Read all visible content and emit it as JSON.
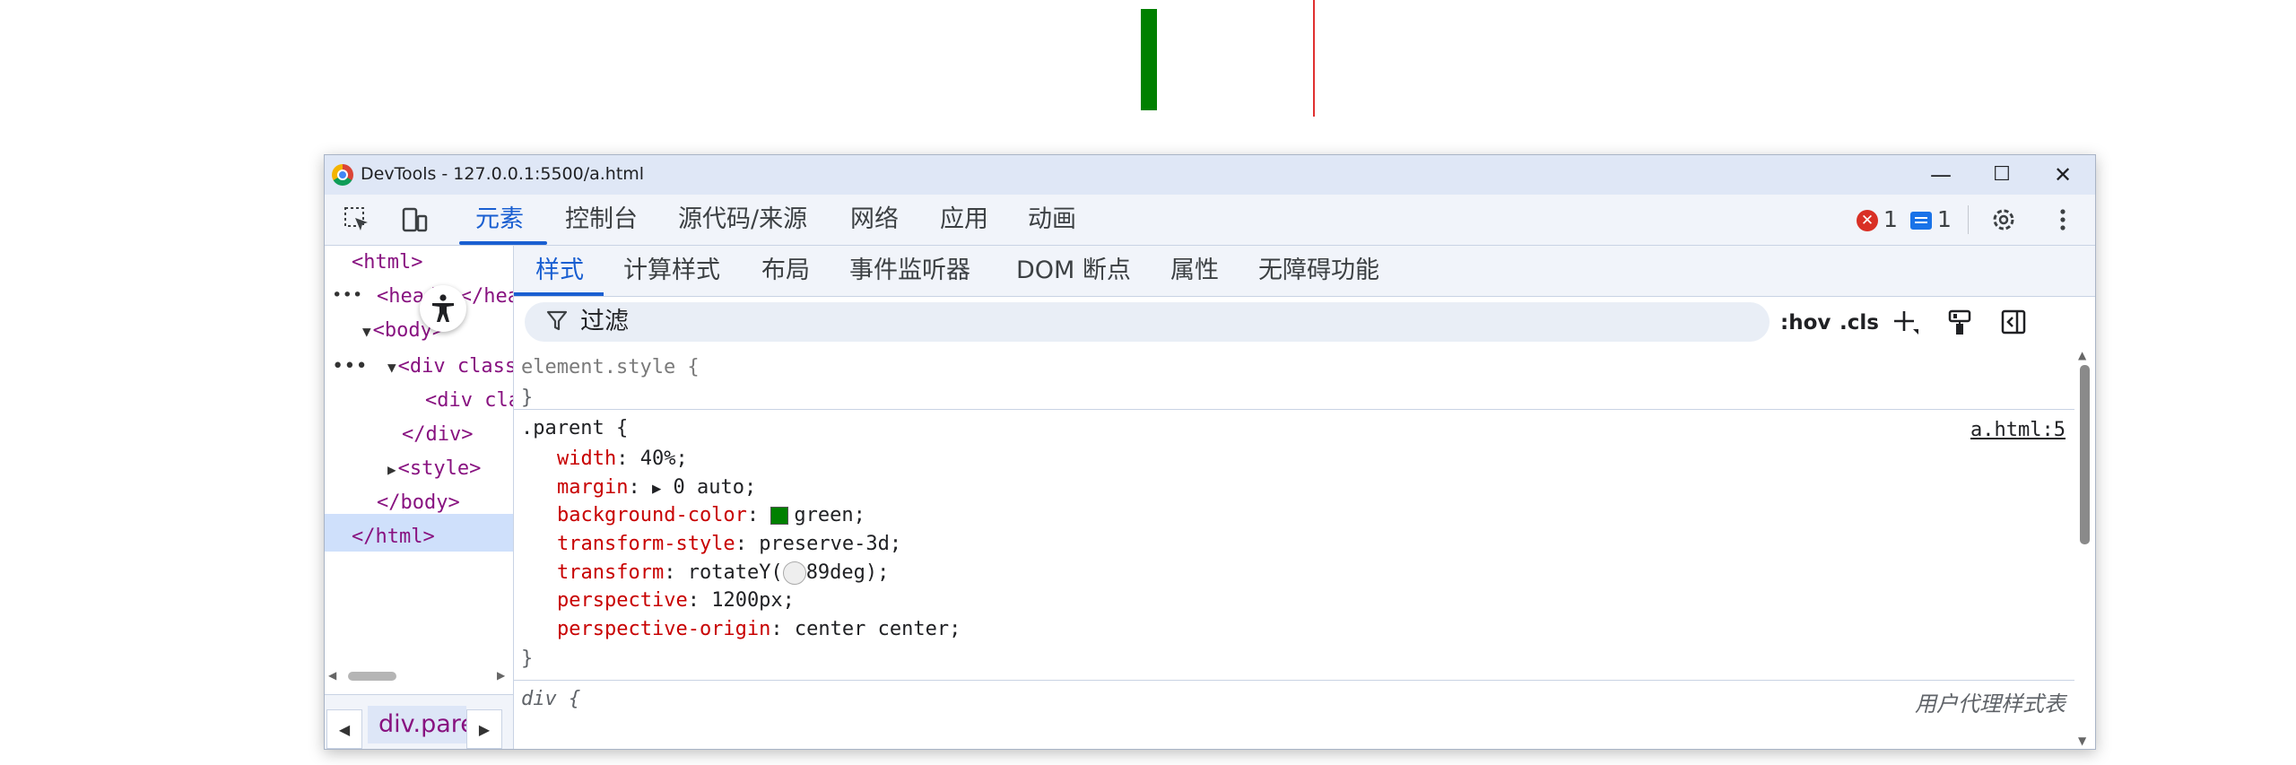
{
  "page": {
    "green_bar_color": "#008000",
    "red_line_color": "#e03030"
  },
  "window": {
    "title": "DevTools - 127.0.0.1:5500/a.html",
    "minimize": "—",
    "maximize": "☐",
    "close": "✕"
  },
  "toolbar": {
    "inspect_icon": "inspect-element-icon",
    "device_icon": "device-toolbar-icon",
    "tabs": [
      "元素",
      "控制台",
      "源代码/来源",
      "网络",
      "应用",
      "动画"
    ],
    "active_tab": "元素",
    "error_count": "1",
    "message_count": "1",
    "settings_icon": "gear-icon",
    "more_icon": "kebab-menu-icon"
  },
  "dom_tree": {
    "lines": [
      {
        "text": "<html>"
      },
      {
        "text": "<head>…</head>"
      },
      {
        "text": "<body>"
      },
      {
        "text": "<div class=\"parent\">"
      },
      {
        "text": "<div class=\"child\">"
      },
      {
        "text": "</div>"
      },
      {
        "text": "<style>"
      },
      {
        "text": "</body>"
      },
      {
        "text": "</html>"
      }
    ],
    "dots": "•••",
    "breadcrumb": "div.parent",
    "bc_left": "◀",
    "bc_right": "▶"
  },
  "subtabs": {
    "items": [
      "样式",
      "计算样式",
      "布局",
      "事件监听器",
      "DOM 断点",
      "属性",
      "无障碍功能"
    ],
    "active": "样式"
  },
  "filter": {
    "placeholder": "过滤",
    "hov": ":hov",
    "cls": ".cls"
  },
  "rules": {
    "element_style": {
      "selector": "element.style {",
      "close": "}"
    },
    "parent": {
      "selector": ".parent {",
      "source": "a.html:5",
      "close": "}",
      "props": [
        {
          "name": "width",
          "value": "40%;"
        },
        {
          "name": "margin",
          "value": "0 auto;"
        },
        {
          "name": "background-color",
          "value": "green;"
        },
        {
          "name": "transform-style",
          "value": "preserve-3d;"
        },
        {
          "name": "transform",
          "value_before": "rotateY(",
          "value_after": "89deg);"
        },
        {
          "name": "perspective",
          "value": "1200px;"
        },
        {
          "name": "perspective-origin",
          "value": "center center;"
        }
      ]
    },
    "div": {
      "selector": "div {",
      "source": "用户代理样式表"
    }
  }
}
